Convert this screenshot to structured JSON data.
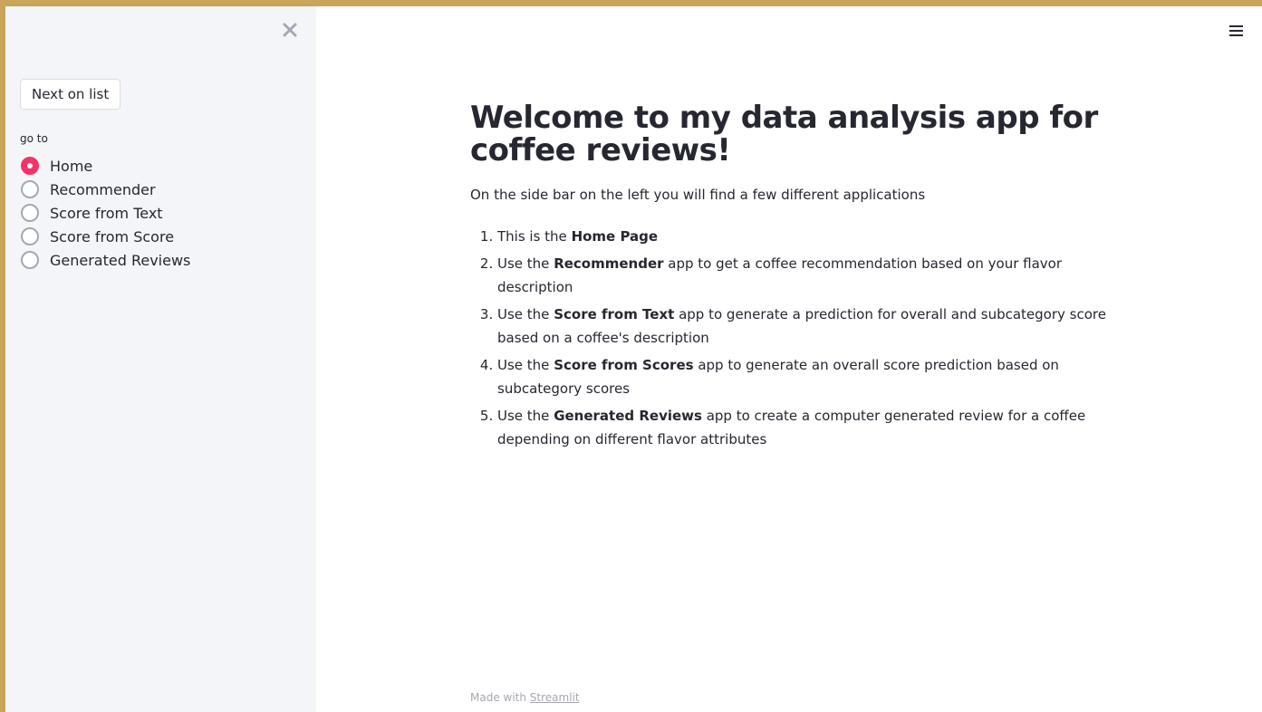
{
  "sidebar": {
    "next_button_label": "Next on list",
    "radio_label": "go to",
    "options": [
      "Home",
      "Recommender",
      "Score from Text",
      "Score from Score",
      "Generated Reviews"
    ],
    "selected": "Home"
  },
  "main": {
    "title": "Welcome to my data analysis app for coffee reviews!",
    "intro": "On the side bar on the left you will find a few different applications",
    "list": [
      {
        "pre": "This is the ",
        "bold": "Home Page",
        "post": ""
      },
      {
        "pre": "Use the ",
        "bold": "Recommender",
        "post": " app to get a coffee recommendation based on your flavor description"
      },
      {
        "pre": "Use the ",
        "bold": "Score from Text",
        "post": " app to generate a prediction for overall and subcategory score based on a coffee's description"
      },
      {
        "pre": "Use the ",
        "bold": "Score from Scores",
        "post": " app to generate an overall score prediction based on subcategory scores"
      },
      {
        "pre": "Use the ",
        "bold": "Generated Reviews",
        "post": " app to create a computer generated review for a coffee depending on different flavor attributes"
      }
    ]
  },
  "footer": {
    "prefix": "Made with ",
    "link": "Streamlit"
  },
  "colors": {
    "accent": "#f63366",
    "frame_border": "#c9a55a",
    "sidebar_bg": "#f4f5f8"
  },
  "icons": {
    "close": "close-icon",
    "menu": "hamburger-menu-icon"
  }
}
